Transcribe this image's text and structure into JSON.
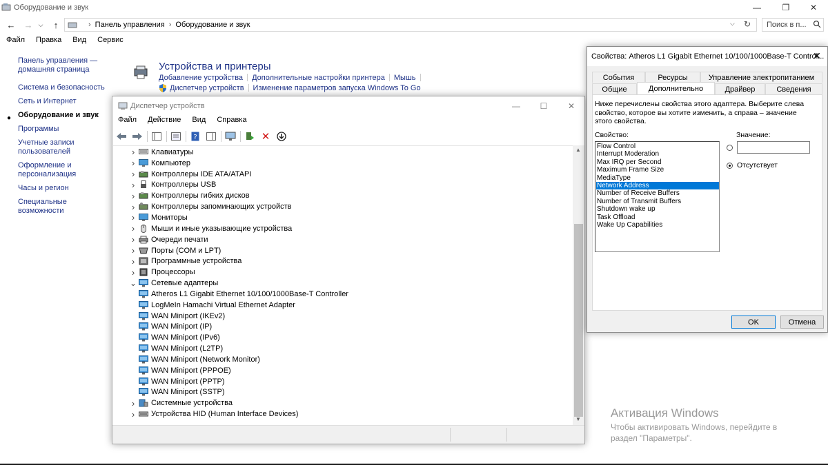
{
  "control_panel": {
    "title": "Оборудование и звук",
    "breadcrumb": [
      "Панель управления",
      "Оборудование и звук"
    ],
    "search_placeholder": "Поиск в п...",
    "menu": [
      "Файл",
      "Правка",
      "Вид",
      "Сервис"
    ],
    "left_nav": [
      "Панель управления — домашняя страница",
      "Система и безопасность",
      "Сеть и Интернет",
      "Оборудование и звук",
      "Программы",
      "Учетные записи пользователей",
      "Оформление и персонализация",
      "Часы и регион",
      "Специальные возможности"
    ],
    "section_title": "Устройства и принтеры",
    "links_row1": [
      "Добавление устройства",
      "Дополнительные настройки принтера",
      "Мышь"
    ],
    "links_row2": [
      "Диспетчер устройств",
      "Изменение параметров запуска Windows To Go"
    ]
  },
  "device_manager": {
    "title": "Диспетчер устройств",
    "menu": [
      "Файл",
      "Действие",
      "Вид",
      "Справка"
    ],
    "tree": [
      {
        "label": "Клавиатуры",
        "expanded": false,
        "icon": "keyboard-icon"
      },
      {
        "label": "Компьютер",
        "expanded": false,
        "icon": "monitor-icon"
      },
      {
        "label": "Контроллеры IDE ATA/ATAPI",
        "expanded": false,
        "icon": "controller-icon"
      },
      {
        "label": "Контроллеры USB",
        "expanded": false,
        "icon": "usb-icon"
      },
      {
        "label": "Контроллеры гибких дисков",
        "expanded": false,
        "icon": "controller-icon"
      },
      {
        "label": "Контроллеры запоминающих устройств",
        "expanded": false,
        "icon": "storage-icon"
      },
      {
        "label": "Мониторы",
        "expanded": false,
        "icon": "monitor-icon"
      },
      {
        "label": "Мыши и иные указывающие устройства",
        "expanded": false,
        "icon": "mouse-icon"
      },
      {
        "label": "Очереди печати",
        "expanded": false,
        "icon": "printer-icon"
      },
      {
        "label": "Порты (COM и LPT)",
        "expanded": false,
        "icon": "port-icon"
      },
      {
        "label": "Программные устройства",
        "expanded": false,
        "icon": "software-icon"
      },
      {
        "label": "Процессоры",
        "expanded": false,
        "icon": "cpu-icon"
      },
      {
        "label": "Сетевые адаптеры",
        "expanded": true,
        "icon": "network-icon"
      },
      {
        "label": "Atheros L1 Gigabit Ethernet 10/100/1000Base-T Controller",
        "child": true,
        "icon": "network-icon"
      },
      {
        "label": "LogMeIn Hamachi Virtual Ethernet Adapter",
        "child": true,
        "icon": "network-icon"
      },
      {
        "label": "WAN Miniport (IKEv2)",
        "child": true,
        "icon": "network-icon"
      },
      {
        "label": "WAN Miniport (IP)",
        "child": true,
        "icon": "network-icon"
      },
      {
        "label": "WAN Miniport (IPv6)",
        "child": true,
        "icon": "network-icon"
      },
      {
        "label": "WAN Miniport (L2TP)",
        "child": true,
        "icon": "network-icon"
      },
      {
        "label": "WAN Miniport (Network Monitor)",
        "child": true,
        "icon": "network-icon"
      },
      {
        "label": "WAN Miniport (PPPOE)",
        "child": true,
        "icon": "network-icon"
      },
      {
        "label": "WAN Miniport (PPTP)",
        "child": true,
        "icon": "network-icon"
      },
      {
        "label": "WAN Miniport (SSTP)",
        "child": true,
        "icon": "network-icon"
      },
      {
        "label": "Системные устройства",
        "expanded": false,
        "icon": "system-icon"
      },
      {
        "label": "Устройства HID (Human Interface Devices)",
        "expanded": false,
        "icon": "hid-icon"
      }
    ]
  },
  "properties": {
    "title": "Свойства: Atheros L1 Gigabit Ethernet 10/100/1000Base-T Control...",
    "tabs_row1": [
      "События",
      "Ресурсы",
      "Управление электропитанием"
    ],
    "tabs_row2": [
      "Общие",
      "Дополнительно",
      "Драйвер",
      "Сведения"
    ],
    "selected_tab": "Дополнительно",
    "description": "Ниже перечислены свойства этого адаптера. Выберите слева свойство, которое вы хотите изменить, а справа – значение этого свойства.",
    "property_label": "Свойство:",
    "value_label": "Значение:",
    "properties": [
      "Flow Control",
      "Interrupt Moderation",
      "Max IRQ per Second",
      "Maximum Frame Size",
      "MediaType",
      "Network Address",
      "Number of Receive Buffers",
      "Number of Transmit Buffers",
      "Shutdown wake up",
      "Task Offload",
      "Wake Up Capabilities"
    ],
    "selected_property": "Network Address",
    "value": "",
    "absent_label": "Отсутствует",
    "ok_label": "OK",
    "cancel_label": "Отмена"
  },
  "watermark": {
    "line1": "Активация Windows",
    "line2": "Чтобы активировать Windows, перейдите в раздел \"Параметры\"."
  }
}
